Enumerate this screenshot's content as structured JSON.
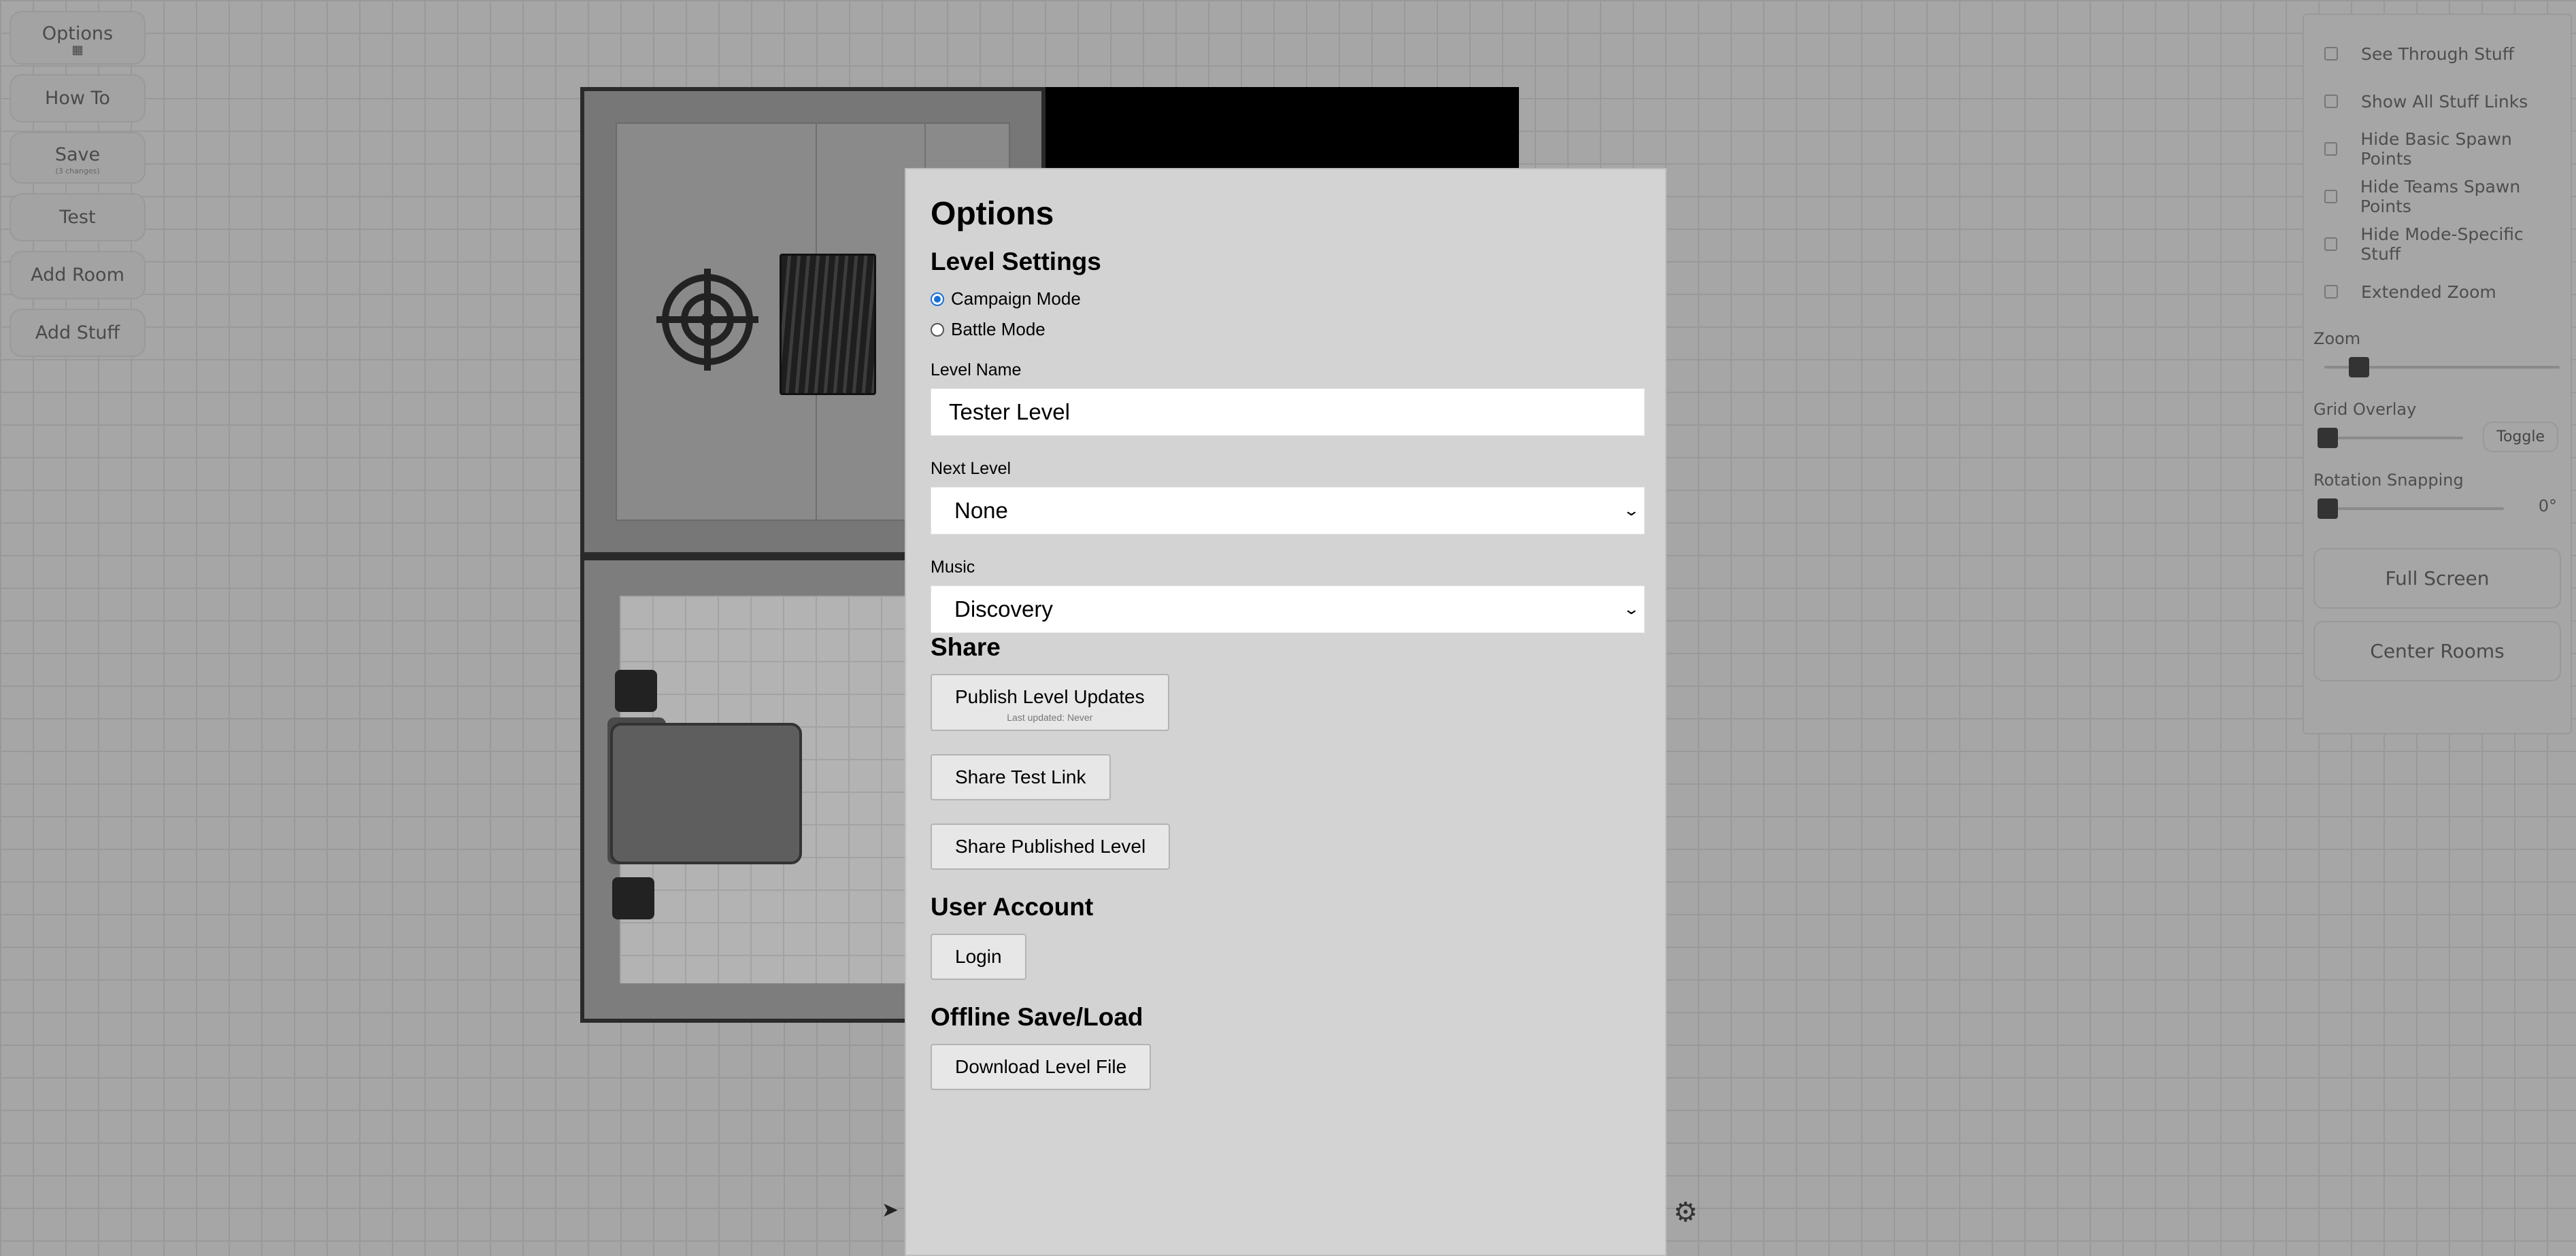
{
  "left_toolbar": {
    "options": "Options",
    "how_to": "How To",
    "save": "Save",
    "save_sub": "(3 changes)",
    "test": "Test",
    "add_room": "Add Room",
    "add_stuff": "Add Stuff"
  },
  "right_panel": {
    "checkboxes": [
      {
        "label": "See Through Stuff",
        "checked": false
      },
      {
        "label": "Show All Stuff Links",
        "checked": false
      },
      {
        "label": "Hide Basic Spawn Points",
        "checked": false
      },
      {
        "label": "Hide Teams Spawn Points",
        "checked": false
      },
      {
        "label": "Hide Mode-Specific Stuff",
        "checked": false
      },
      {
        "label": "Extended Zoom",
        "checked": false
      }
    ],
    "zoom_label": "Zoom",
    "grid_label": "Grid Overlay",
    "grid_toggle": "Toggle",
    "rotation_label": "Rotation Snapping",
    "rotation_value": "0°",
    "full_screen": "Full Screen",
    "center_rooms": "Center Rooms"
  },
  "modal": {
    "title": "Options",
    "level_settings": {
      "heading": "Level Settings",
      "modes": [
        {
          "label": "Campaign Mode",
          "selected": true
        },
        {
          "label": "Battle Mode",
          "selected": false
        }
      ],
      "level_name_label": "Level Name",
      "level_name_value": "Tester Level",
      "next_level_label": "Next Level",
      "next_level_value": "None",
      "music_label": "Music",
      "music_value": "Discovery"
    },
    "share": {
      "heading": "Share",
      "publish": "Publish Level Updates",
      "publish_sub": "Last updated: Never",
      "share_test": "Share Test Link",
      "share_published": "Share Published Level"
    },
    "account": {
      "heading": "User Account",
      "login": "Login"
    },
    "offline": {
      "heading": "Offline Save/Load",
      "download": "Download Level File"
    }
  },
  "icons": {
    "pointer": "cursor-arrow-icon",
    "settings": "gear-icon",
    "target": "target-icon"
  }
}
